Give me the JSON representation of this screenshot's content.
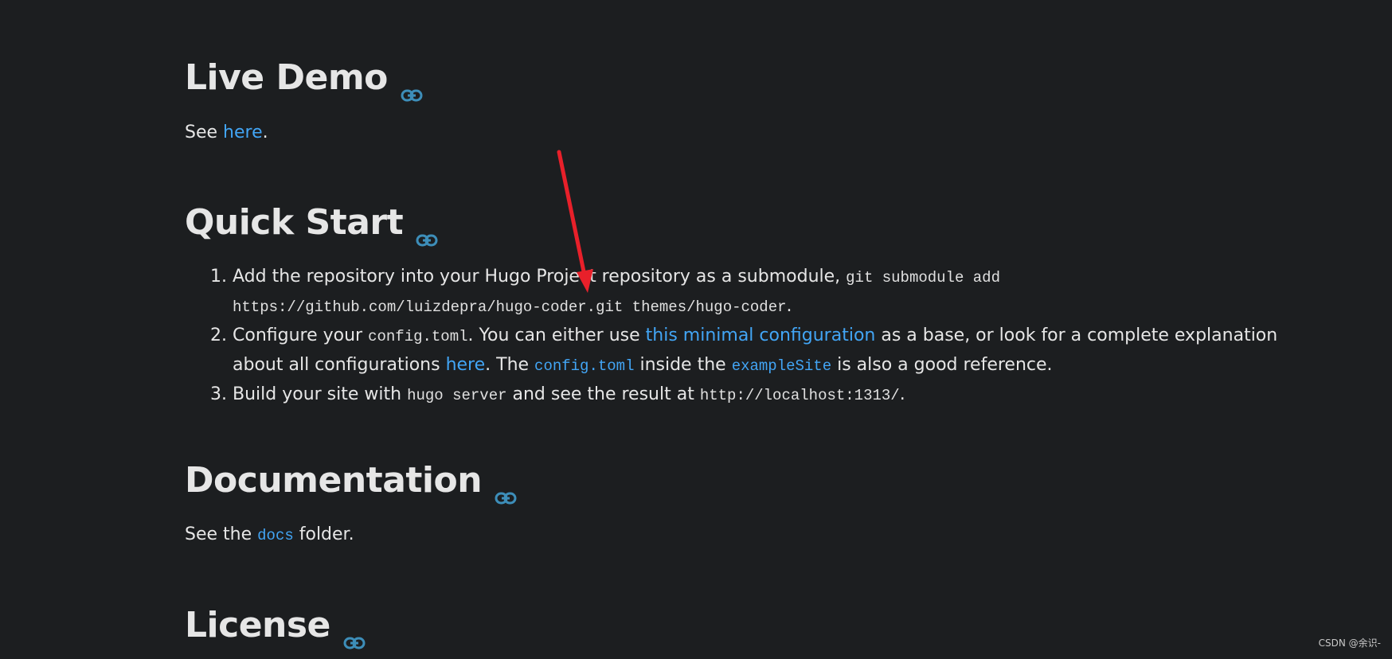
{
  "sections": {
    "live_demo": {
      "title": "Live Demo",
      "text_before": "See ",
      "link": "here",
      "text_after": "."
    },
    "quick_start": {
      "title": "Quick Start",
      "steps": [
        {
          "text1": "Add the repository into your Hugo Project repository as a submodule, ",
          "code1": "git submodule add https://github.com/luizdepra/hugo-coder.git themes/hugo-coder",
          "text2": "."
        },
        {
          "text1": "Configure your ",
          "code1": "config.toml",
          "text2": ". You can either use ",
          "link1": "this minimal configuration",
          "text3": " as a base, or look for a complete explanation about all configurations ",
          "link2": "here",
          "text4": ". The ",
          "code2": "config.toml",
          "text5": " inside the ",
          "code3": "exampleSite",
          "text6": " is also a good reference."
        },
        {
          "text1": "Build your site with ",
          "code1": "hugo server",
          "text2": " and see the result at ",
          "code2": "http://localhost:1313/",
          "text3": "."
        }
      ]
    },
    "documentation": {
      "title": "Documentation",
      "text_before": "See the ",
      "code": "docs",
      "text_after": " folder."
    },
    "license": {
      "title": "License"
    }
  },
  "watermark": "CSDN @余识-",
  "colors": {
    "background": "#1c1e20",
    "text": "#e6e6e6",
    "link": "#42a5f5",
    "anchor_icon": "#3d8eb9",
    "annotation_arrow": "#e8202a"
  },
  "icons": {
    "heading_anchor": "link-icon",
    "annotation": "red-arrow"
  }
}
